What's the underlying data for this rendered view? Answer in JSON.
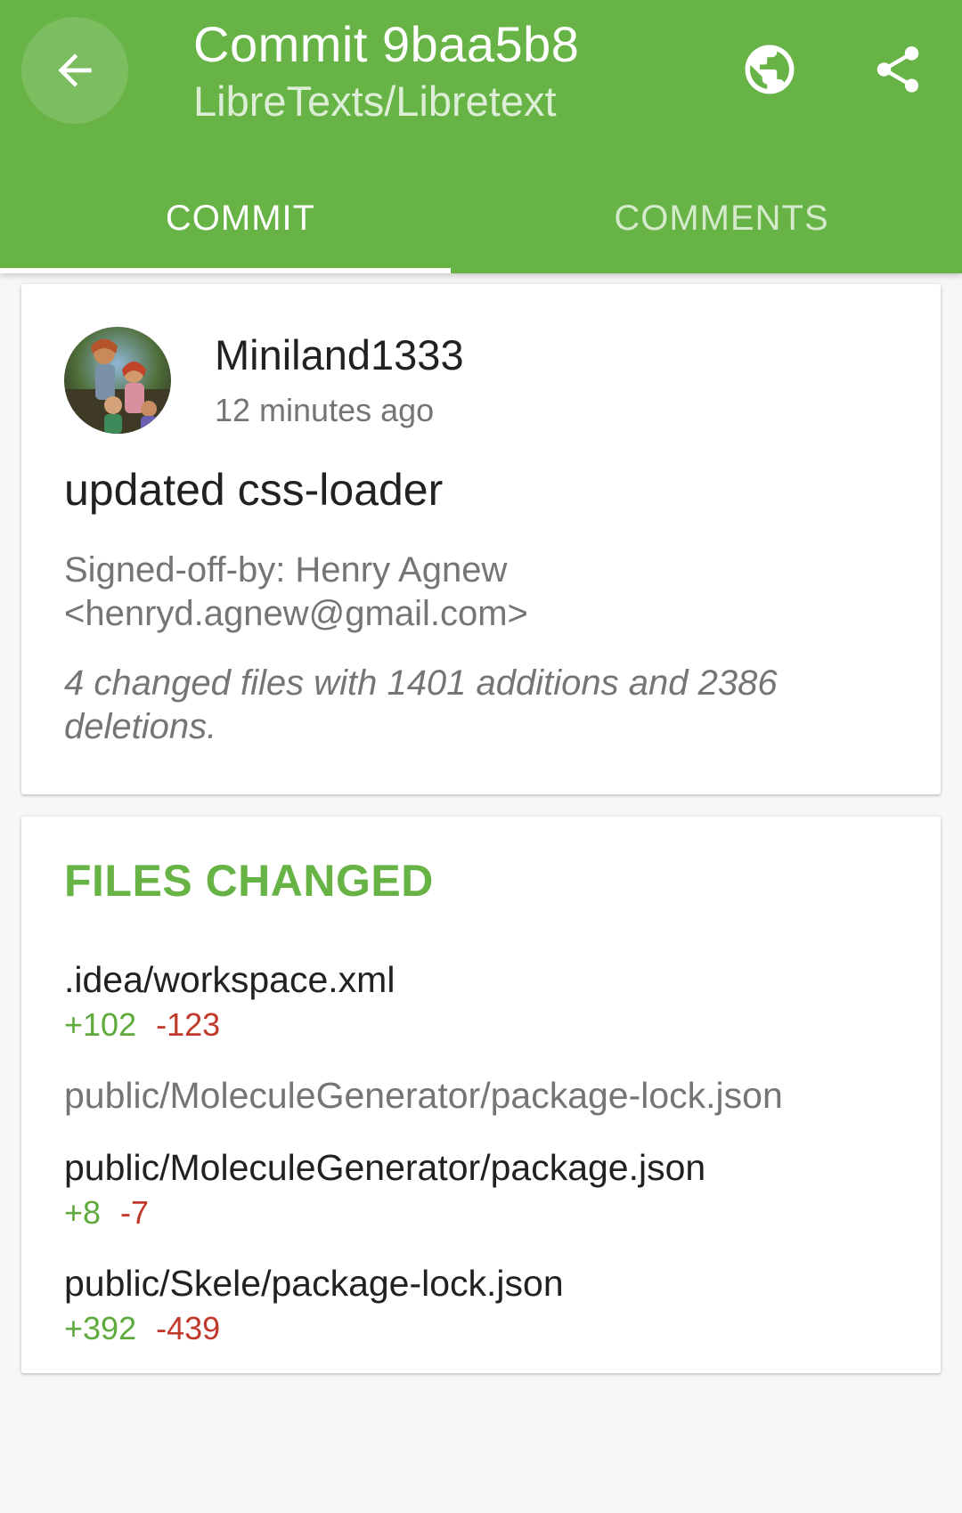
{
  "appbar": {
    "title": "Commit 9baa5b8",
    "subtitle": "LibreTexts/Libretext",
    "back_icon": "arrow-back-icon",
    "globe_icon": "globe-icon",
    "share_icon": "share-icon",
    "color": "#67b346"
  },
  "tabs": [
    {
      "label": "COMMIT",
      "active": true
    },
    {
      "label": "COMMENTS",
      "active": false
    }
  ],
  "commit": {
    "author": "Miniland1333",
    "time": "12 minutes ago",
    "message": "updated css-loader",
    "signoff": "Signed-off-by: Henry Agnew <henryd.agnew@gmail.com>",
    "summary": "4 changed files with 1401 additions and 2386 deletions."
  },
  "files": {
    "header": "FILES CHANGED",
    "items": [
      {
        "name": ".idea/workspace.xml",
        "additions": "+102",
        "deletions": "-123"
      },
      {
        "name": "public/MoleculeGenerator/package-lock.json"
      },
      {
        "name": "public/MoleculeGenerator/package.json",
        "additions": "+8",
        "deletions": "-7"
      },
      {
        "name": "public/Skele/package-lock.json",
        "additions": "+392",
        "deletions": "-439"
      }
    ]
  },
  "colors": {
    "addition": "#5faa3c",
    "deletion": "#c0392b"
  }
}
